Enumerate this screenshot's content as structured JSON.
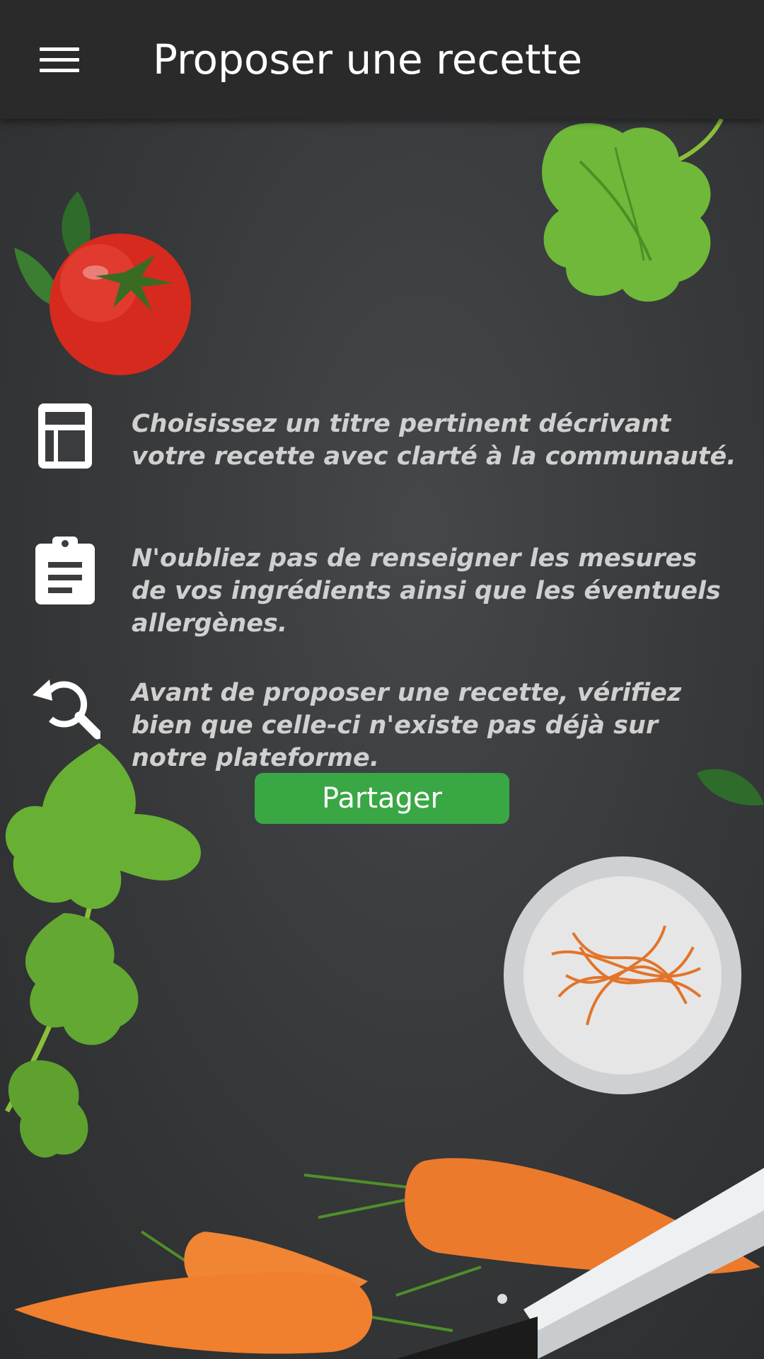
{
  "appbar": {
    "title": "Proposer une recette",
    "menu_icon": "hamburger-menu-icon"
  },
  "tips": [
    {
      "icon": "form-list-icon",
      "text": "Choisissez un titre pertinent décrivant votre recette avec clarté à la communauté."
    },
    {
      "icon": "clipboard-icon",
      "text": "N'oubliez pas de renseigner les mesures de vos ingrédients ainsi que les éventuels allergènes."
    },
    {
      "icon": "search-refresh-icon",
      "text": "Avant de proposer une recette, vérifiez bien que celle-ci n'existe pas déjà sur notre plateforme."
    }
  ],
  "share_button": {
    "label": "Partager"
  },
  "colors": {
    "appbar": "#2a2a2a",
    "background": "#3a3c3e",
    "accent": "#3aa745",
    "tip_text": "#d0d0d0"
  }
}
